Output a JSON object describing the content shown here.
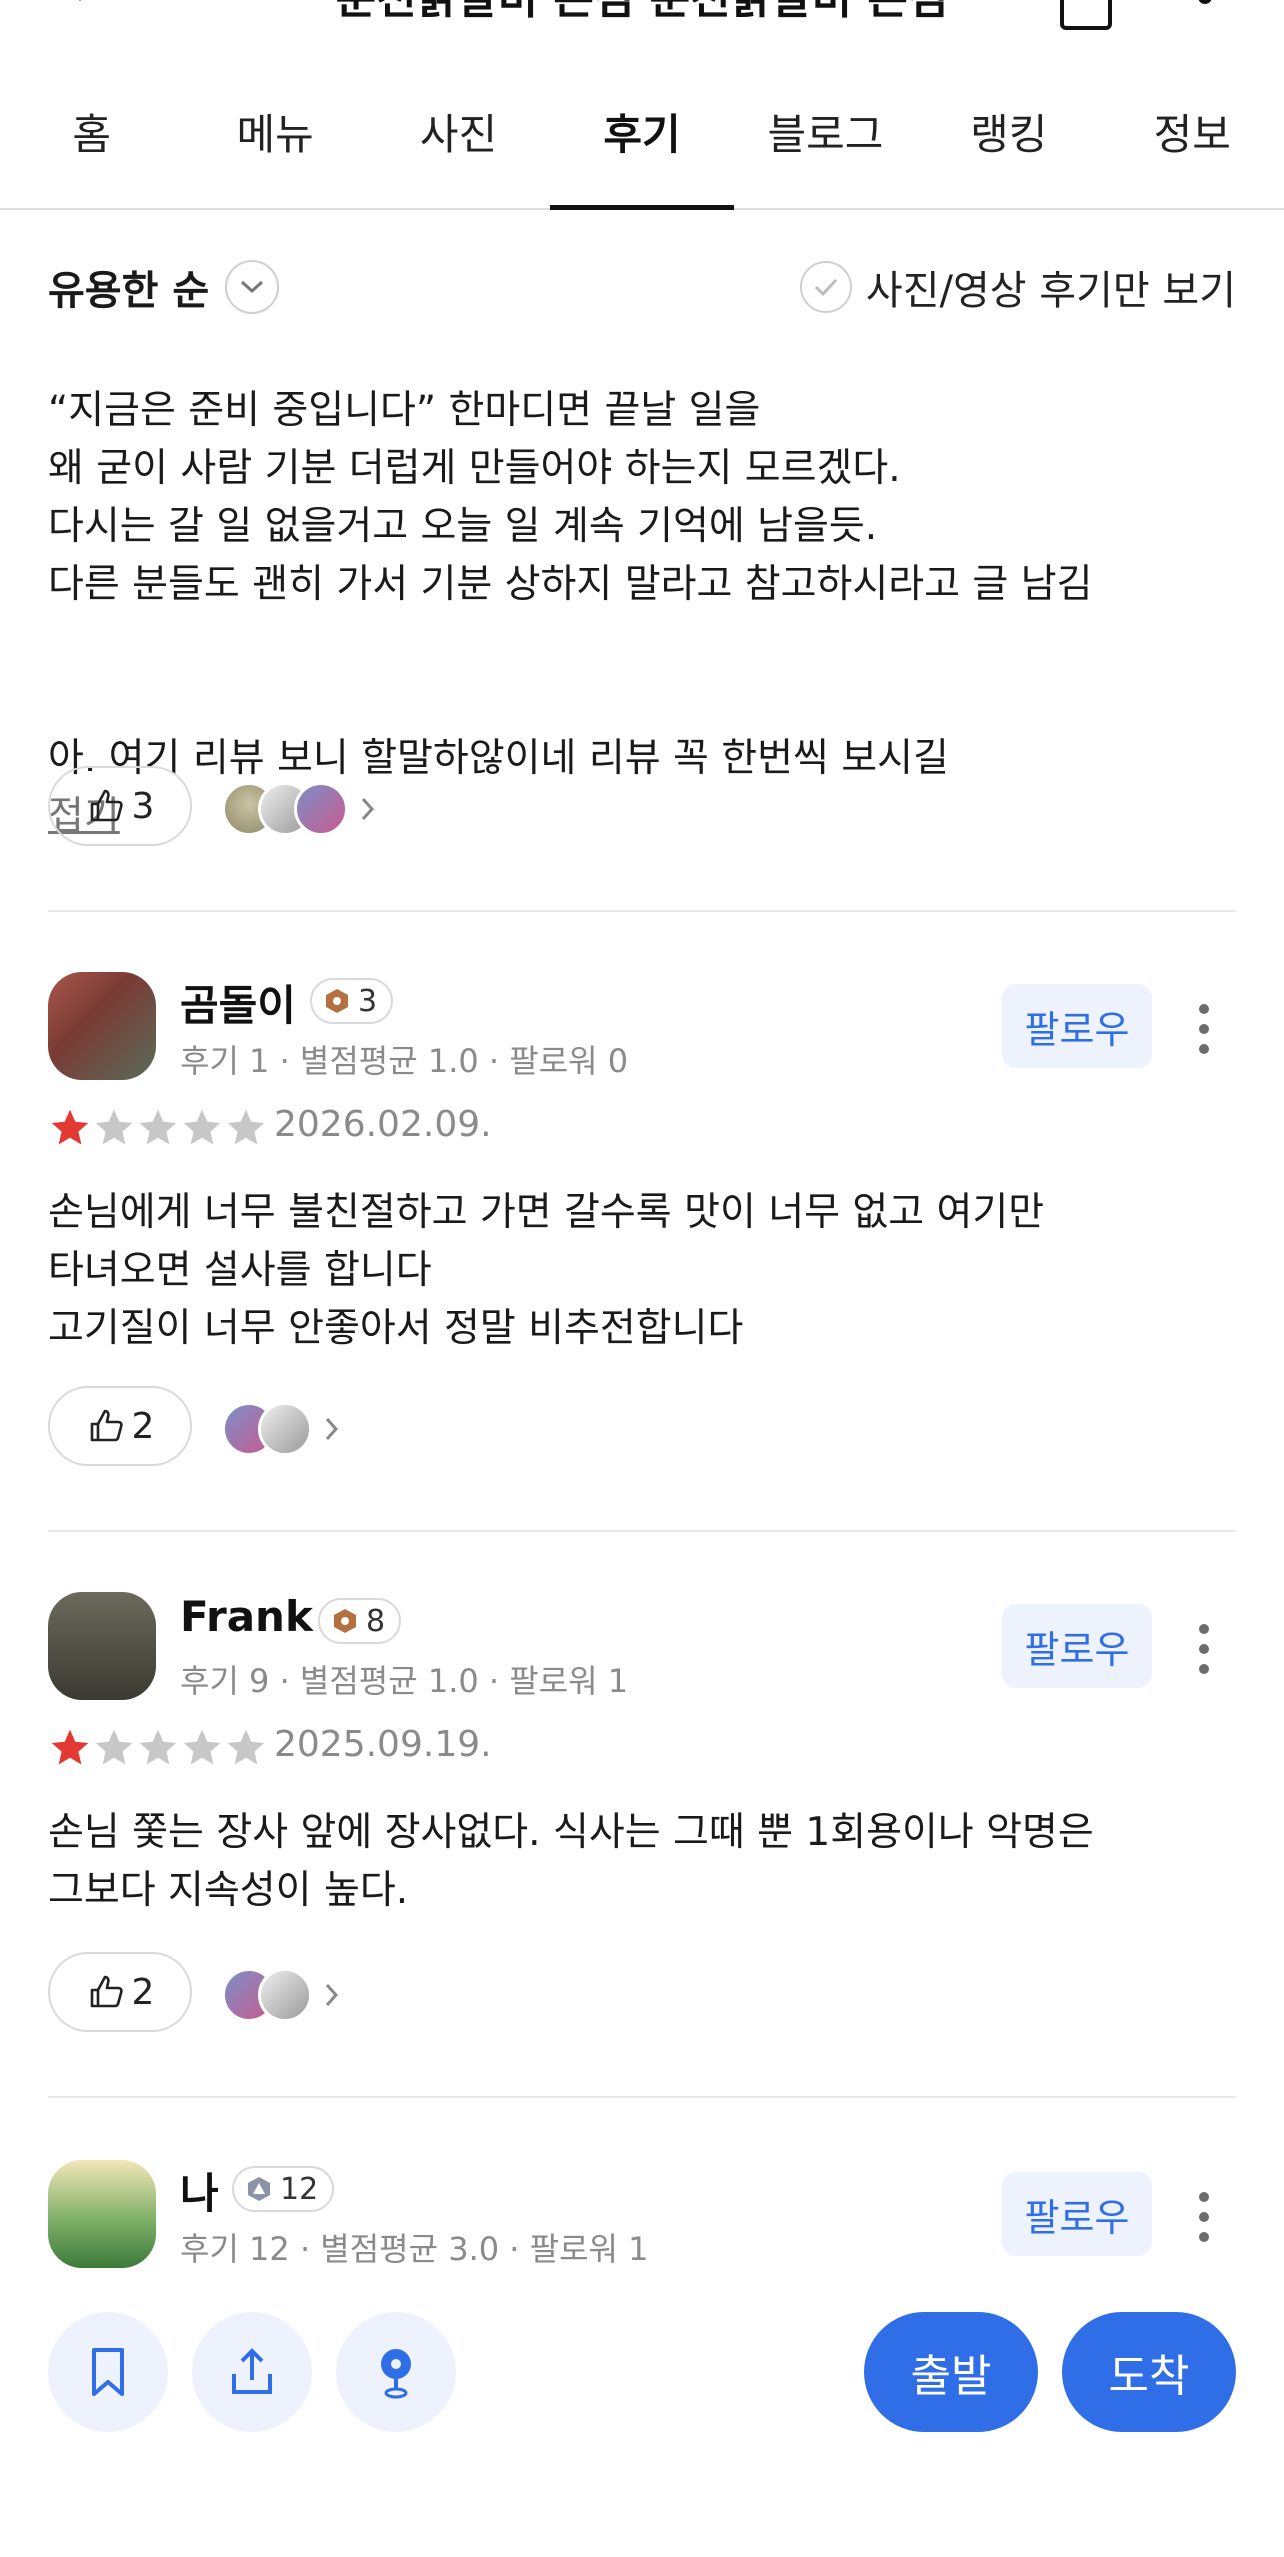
{
  "header": {
    "title": "춘천닭갈비 본점 춘천닭갈비 본점"
  },
  "tabs": [
    {
      "label": "홈"
    },
    {
      "label": "메뉴"
    },
    {
      "label": "사진"
    },
    {
      "label": "후기"
    },
    {
      "label": "블로그"
    },
    {
      "label": "랭킹"
    },
    {
      "label": "정보"
    }
  ],
  "sort": {
    "label": "유용한 순",
    "filter_label": "사진/영상 후기만 보기"
  },
  "prev_review": {
    "text": "“지금은 준비 중입니다” 한마디면 끝날 일을\n왜 굳이 사람 기분 더럽게 만들어야 하는지 모르겠다.\n다시는 갈 일 없을거고 오늘 일 계속 기억에 남을듯.\n다른 분들도 괜히 가서 기분 상하지 말라고 참고하시라고 글 남김",
    "text2": "아. 여기 리뷰 보니 할말하않이네 리뷰 꼭 한번씩 보시길",
    "fold_label": "접기",
    "likes": "3"
  },
  "reviews": [
    {
      "name": "곰돌이",
      "level": "3",
      "stats": "후기 1 · 별점평균 1.0 · 팔로워 0",
      "follow_label": "팔로우",
      "rating": 1,
      "date": "2026.02.09.",
      "text": "손님에게 너무 불친절하고 가면 갈수록 맛이 너무 없고    여기만\n타녀오면 설사를 합니다\n고기질이 너무 안좋아서 정말 비추전합니다",
      "likes": "2"
    },
    {
      "name": "Frank",
      "level": "8",
      "stats": "후기 9 · 별점평균 1.0 · 팔로워 1",
      "follow_label": "팔로우",
      "rating": 1,
      "date": "2025.09.19.",
      "text": "손님 쫓는 장사 앞에 장사없다. 식사는 그때 뿐 1회용이나 악명은\n그보다 지속성이 높다.",
      "likes": "2"
    },
    {
      "name": "나",
      "level": "12",
      "stats": "후기 12 · 별점평균 3.0 · 팔로워 1",
      "follow_label": "팔로우"
    }
  ],
  "bottom": {
    "depart_label": "출발",
    "arrive_label": "도착"
  },
  "colors": {
    "accent": "#2f6ee6",
    "accent_bg": "#edf2fd",
    "star_active": "#e23a32",
    "star_inactive": "#c7c7c7"
  }
}
